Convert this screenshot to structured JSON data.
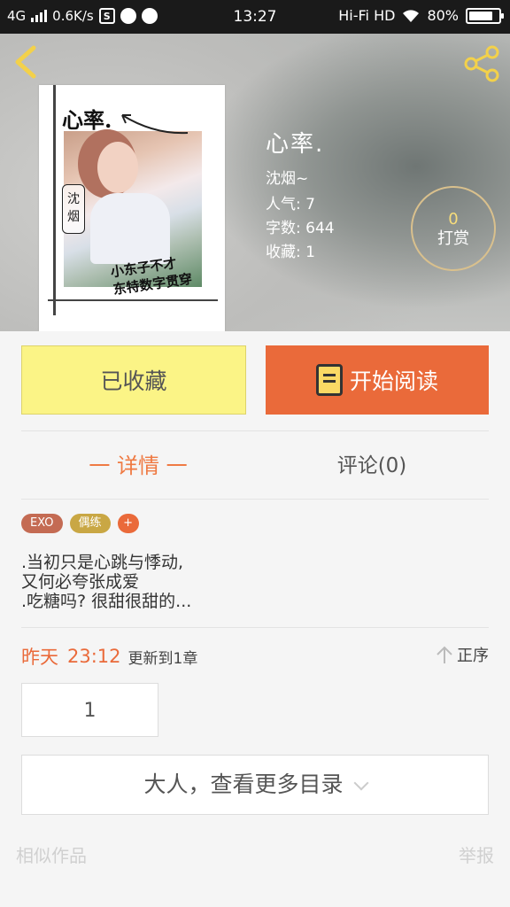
{
  "status_bar": {
    "network": "4G",
    "speed": "0.6K/s",
    "time": "13:27",
    "hifi": "Hi-Fi HD",
    "battery_text": "80%",
    "battery_level": 0.8
  },
  "book": {
    "cover_title": "心率.",
    "cover_tag": "沈烟",
    "cover_signature": "小东子不才\n东特数字贯穿",
    "title": "心率.",
    "author": "沈烟~",
    "popularity": "人气: 7",
    "word_count": "字数: 644",
    "favorites": "收藏: 1"
  },
  "tip": {
    "count": "0",
    "label": "打赏"
  },
  "actions": {
    "collect_label": "已收藏",
    "read_label": "开始阅读"
  },
  "tabs": {
    "detail": "一  详情  一",
    "comment": "评论(0)"
  },
  "tags": {
    "exo": "EXO",
    "ouxl": "偶练",
    "add": "+"
  },
  "description": ".当初只是心跳与悸动,\n又何必夸张成爱\n.吃糖吗? 很甜很甜的...",
  "update": {
    "day": "昨天",
    "time": "23:12",
    "text": "更新到1章",
    "sort_label": "正序"
  },
  "chapter": {
    "number": "1"
  },
  "more": {
    "label": "大人，查看更多目录"
  },
  "footer": {
    "similar": "相似作品",
    "report": "举报"
  },
  "colors": {
    "accent": "#ea6a3a",
    "collect_bg": "#fbf486",
    "tip_count": "#f7dd7b"
  }
}
